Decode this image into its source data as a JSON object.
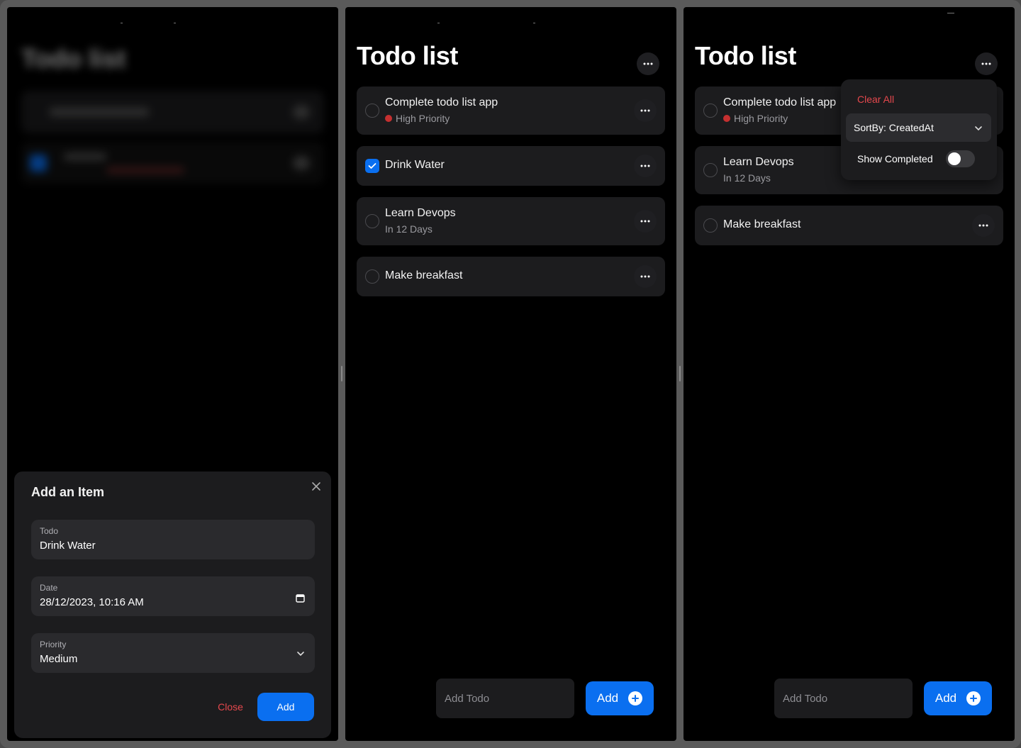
{
  "app": {
    "title": "Todo list",
    "add_placeholder": "Add Todo",
    "add_label": "Add"
  },
  "modal": {
    "title": "Add an Item",
    "todo_label": "Todo",
    "todo_value": "Drink Water",
    "date_label": "Date",
    "date_value": "28/12/2023, 10:16 AM",
    "priority_label": "Priority",
    "priority_value": "Medium",
    "close_label": "Close",
    "add_label": "Add"
  },
  "panel2": {
    "todos": [
      {
        "title": "Complete todo list app",
        "subtitle": "High Priority",
        "checked": false
      },
      {
        "title": "Drink Water",
        "subtitle": "",
        "checked": true
      },
      {
        "title": "Learn Devops",
        "subtitle": "In 12 Days",
        "checked": false
      },
      {
        "title": "Make breakfast",
        "subtitle": "",
        "checked": false
      }
    ]
  },
  "panel3": {
    "todos": [
      {
        "title": "Complete todo list app",
        "subtitle": "High Priority",
        "checked": false
      },
      {
        "title": "Learn Devops",
        "subtitle": "In 12 Days",
        "checked": false
      },
      {
        "title": "Make breakfast",
        "subtitle": "",
        "checked": false
      }
    ],
    "menu": {
      "clear_all": "Clear All",
      "sort_by": "SortBy: CreatedAt",
      "show_completed": "Show Completed",
      "show_completed_on": false
    }
  },
  "colors": {
    "accent": "#0a6ff0",
    "danger": "#e5484d",
    "priority_high": "#c53030"
  }
}
